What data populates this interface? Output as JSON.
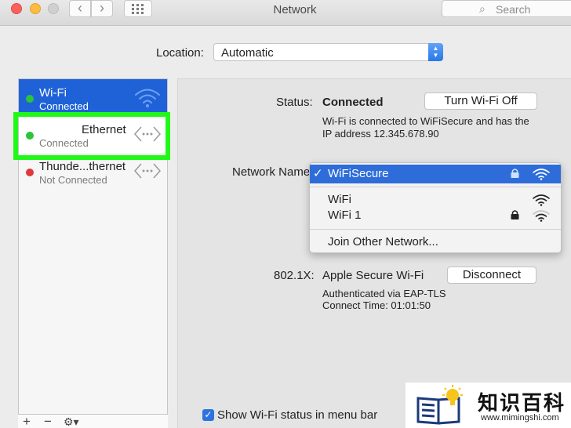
{
  "window": {
    "title": "Network",
    "search_placeholder": "Search"
  },
  "location": {
    "label": "Location:",
    "value": "Automatic"
  },
  "sidebar": {
    "services": [
      {
        "name": "Wi-Fi",
        "status": "Connected"
      },
      {
        "name": "Ethernet",
        "status": "Connected"
      },
      {
        "name": "Thunde...thernet",
        "status": "Not Connected"
      }
    ],
    "tools": {
      "add": "+",
      "remove": "−",
      "gear": "⚙▾"
    }
  },
  "detail": {
    "status_label": "Status:",
    "status_value": "Connected",
    "turn_off_button": "Turn Wi-Fi Off",
    "status_desc_1": "Wi-Fi is connected to WiFiSecure and has the",
    "status_desc_2": "IP address 12.345.678.90",
    "network_name_label": "Network Name",
    "auth_label": "802.1X:",
    "auth_value": "Apple Secure Wi-Fi",
    "disconnect_button": "Disconnect",
    "auth_desc_1": "Authenticated via EAP-TLS",
    "auth_desc_2": "Connect Time: 01:01:50",
    "show_status_label": "Show Wi-Fi status in menu bar"
  },
  "network_menu": {
    "selected": {
      "check": "✓",
      "name": "WiFiSecure"
    },
    "others": [
      {
        "name": "WiFi"
      },
      {
        "name": "WiFi 1"
      }
    ],
    "join_other": "Join Other Network..."
  },
  "watermark": {
    "brand": "知识百科",
    "url": "www.mimingshi.com"
  },
  "colors": {
    "accent": "#1f62d8",
    "highlight": "#21f81a",
    "connected": "#2bc43a",
    "disconnected": "#e0383b"
  }
}
